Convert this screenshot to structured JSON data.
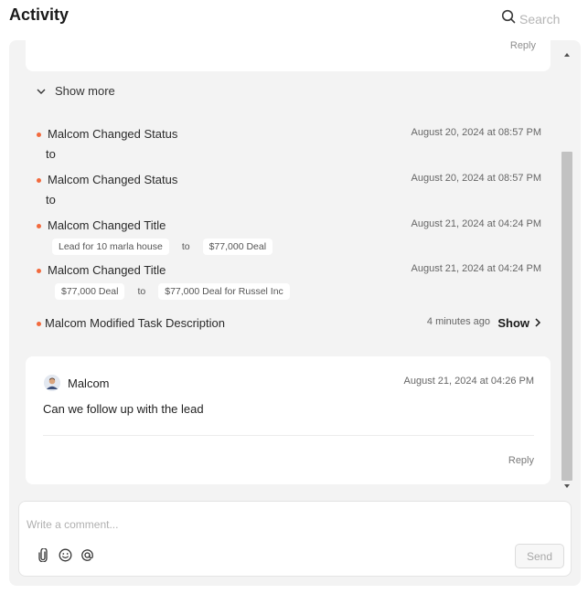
{
  "header": {
    "title": "Activity",
    "search_label": "Search"
  },
  "thread": {
    "top_card_reply": "Reply",
    "show_more_label": "Show more",
    "activities": [
      {
        "text": "Malcom Changed Status",
        "time": "August 20, 2024 at 08:57 PM",
        "sub": "to"
      },
      {
        "text": "Malcom Changed Status",
        "time": "August 20, 2024 at 08:57 PM",
        "sub": "to"
      },
      {
        "text": "Malcom Changed Title",
        "time": "August 21, 2024 at 04:24 PM",
        "from": "Lead for 10 marla house",
        "to_label": "to",
        "to": "$77,000 Deal"
      },
      {
        "text": "Malcom Changed Title",
        "time": "August 21, 2024 at 04:24 PM",
        "from": "$77,000 Deal",
        "to_label": "to",
        "to": "$77,000 Deal for Russel Inc"
      },
      {
        "text": "Malcom Modified Task Description",
        "time": "4 minutes ago",
        "show_label": "Show"
      }
    ],
    "comment": {
      "author": "Malcom",
      "time": "August 21, 2024 at 04:26 PM",
      "body": "Can we follow up with the lead",
      "reply_label": "Reply"
    }
  },
  "composer": {
    "placeholder": "Write a comment...",
    "send_label": "Send"
  },
  "colors": {
    "bullet": "#f26a3d",
    "panel_bg": "#f3f3f3",
    "card_bg": "#ffffff"
  },
  "icons": {
    "search": "search-icon",
    "show_more": "chevron-down-icon",
    "show": "chevron-right-icon",
    "attach": "paperclip-icon",
    "emoji": "smiley-icon",
    "mention": "at-icon"
  }
}
